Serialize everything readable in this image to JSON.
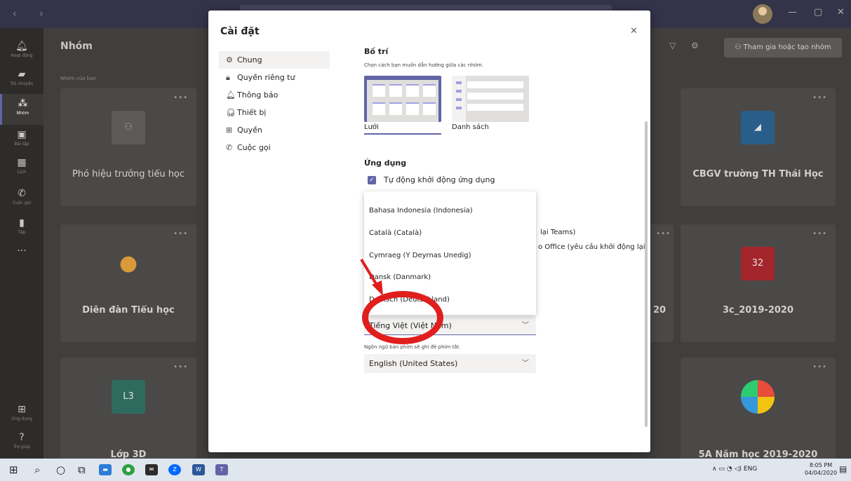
{
  "main": {
    "title": "Nhóm",
    "subtitle": "Nhóm của bạn",
    "join_label": "Tham gia hoặc tạo nhóm",
    "teams": [
      {
        "name": "Phó hiệu trưởng tiểu học"
      },
      {
        "name": "CBGV trường TH Thái Học"
      },
      {
        "name": "Diễn đàn Tiểu học"
      },
      {
        "name": "20"
      },
      {
        "name": "3c_2019-2020",
        "tile": "32"
      },
      {
        "name": "Lớp 3D",
        "tile": "L3"
      },
      {
        "name": "5A Năm học 2019-2020"
      }
    ]
  },
  "rail": {
    "items": [
      {
        "label": "Hoạt động"
      },
      {
        "label": "Trò chuyện"
      },
      {
        "label": "Nhóm"
      },
      {
        "label": "Bài tập"
      },
      {
        "label": "Lịch"
      },
      {
        "label": "Cuộc gọi"
      },
      {
        "label": "Tệp"
      },
      {
        "label": "..."
      },
      {
        "label": "Ứng dụng"
      },
      {
        "label": "Trợ giúp"
      }
    ]
  },
  "modal": {
    "title": "Cài đặt",
    "menu": [
      {
        "label": "Chung",
        "icon": "gear-icon"
      },
      {
        "label": "Quyền riêng tư",
        "icon": "lock-icon"
      },
      {
        "label": "Thông báo",
        "icon": "bell-icon"
      },
      {
        "label": "Thiết bị",
        "icon": "headset-icon"
      },
      {
        "label": "Quyền",
        "icon": "permissions-icon"
      },
      {
        "label": "Cuộc gọi",
        "icon": "phone-icon"
      }
    ],
    "layout": {
      "title": "Bố trí",
      "subtitle": "Chọn cách bạn muốn dẫn hướng giữa các nhóm.",
      "grid_label": "Lưới",
      "list_label": "Danh sách"
    },
    "app": {
      "title": "Ứng dụng",
      "autostart_label": "Tự động khởi động ứng dụng",
      "partial_teams": "lại Teams)",
      "partial_office": "o Office (yêu cầu khởi động lại"
    },
    "language_options": [
      "Bahasa Indonesia (Indonesia)",
      "Català (Català)",
      "Cymraeg (Y Deyrnas Unedig)",
      "Dansk (Danmark)",
      "Deutsch (Deutschland)"
    ],
    "app_language_value": "Tiếng Việt (Việt Nam)",
    "keyboard_hint": "Ngôn ngữ bàn phím sẽ ghi đè phím tắt.",
    "keyboard_language_value": "English (United States)"
  },
  "taskbar": {
    "lang": "ENG",
    "time": "8:05 PM",
    "date": "04/04/2020"
  },
  "colors": {
    "accent": "#6264a7",
    "annotation": "#e01e1e"
  }
}
